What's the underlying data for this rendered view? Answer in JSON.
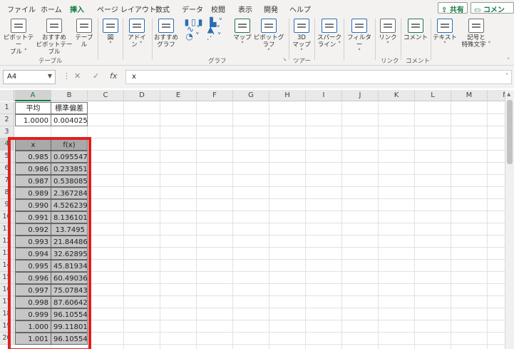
{
  "menu": {
    "tabs": [
      "ファイル",
      "ホーム",
      "挿入",
      "ページ レイアウト",
      "数式",
      "データ",
      "校閲",
      "表示",
      "開発",
      "ヘルプ"
    ],
    "active_tab": "挿入",
    "share_label": "共有",
    "comment_label": "コメント"
  },
  "ribbon": {
    "pivot_table": "ピボットテー\nブル ˅",
    "recommended_pivot": "おすすめ\nピボットテーブル",
    "table": "テーブル",
    "group_table": "テーブル",
    "figure": "図\n˅",
    "addin": "アドイ\nン ˅",
    "recommended_chart": "おすすめ\nグラフ",
    "map": "マップ\n˅",
    "pivot_chart": "ピボットグラフ\n˅",
    "group_chart": "グラフ",
    "map3d": "3D\nマップ ˅",
    "group_tour": "ツアー",
    "sparkline": "スパーク\nライン ˅",
    "filter": "フィルター\n˅",
    "link": "リンク\n˅",
    "group_link": "リンク",
    "comment": "コメント",
    "group_comment": "コメント",
    "text": "テキスト\n˅",
    "symbol": "記号と\n特殊文字 ˅"
  },
  "formula_bar": {
    "name_box": "A4",
    "fx": "fx",
    "value": "x"
  },
  "columns": [
    "A",
    "B",
    "C",
    "D",
    "E",
    "F",
    "G",
    "H",
    "I",
    "J",
    "K",
    "L",
    "M",
    "N"
  ],
  "rows": [
    "1",
    "2",
    "3",
    "4",
    "5",
    "6",
    "7",
    "8",
    "9",
    "10",
    "11",
    "12",
    "13",
    "14",
    "15",
    "16",
    "17",
    "18",
    "19",
    "20"
  ],
  "cells": {
    "a1": "平均",
    "b1": "標準偏差",
    "a2": "1.0000",
    "b2": "0.004025",
    "a4": "x",
    "b4": "f(x)"
  },
  "table": [
    {
      "x": "0.985",
      "fx": "0.095547"
    },
    {
      "x": "0.986",
      "fx": "0.233851"
    },
    {
      "x": "0.987",
      "fx": "0.538085"
    },
    {
      "x": "0.989",
      "fx": "2.367284"
    },
    {
      "x": "0.990",
      "fx": "4.526239"
    },
    {
      "x": "0.991",
      "fx": "8.136101"
    },
    {
      "x": "0.992",
      "fx": "13.7495"
    },
    {
      "x": "0.993",
      "fx": "21.84486"
    },
    {
      "x": "0.994",
      "fx": "32.62895"
    },
    {
      "x": "0.995",
      "fx": "45.81934"
    },
    {
      "x": "0.996",
      "fx": "60.49036"
    },
    {
      "x": "0.997",
      "fx": "75.07843"
    },
    {
      "x": "0.998",
      "fx": "87.60642"
    },
    {
      "x": "0.999",
      "fx": "96.10554"
    },
    {
      "x": "1.000",
      "fx": "99.11801"
    },
    {
      "x": "1.001",
      "fx": "96.10554"
    }
  ],
  "colors": {
    "accent": "#107c41",
    "highlight": "#e02020"
  }
}
